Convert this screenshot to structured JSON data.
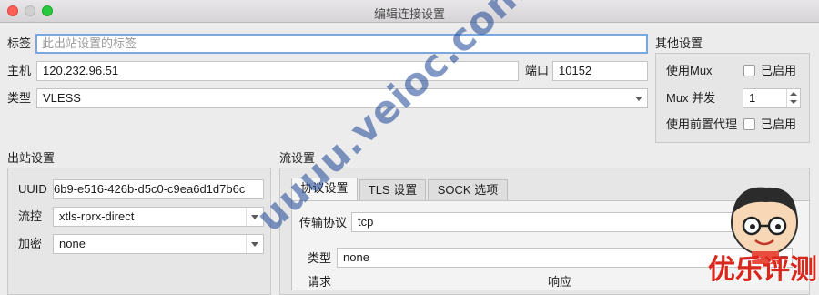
{
  "window": {
    "title": "编辑连接设置"
  },
  "form": {
    "tag_label": "标签",
    "tag_placeholder": "此出站设置的标签",
    "host_label": "主机",
    "host_value": "120.232.96.51",
    "port_label": "端口",
    "port_value": "10152",
    "type_label": "类型",
    "type_value": "VLESS"
  },
  "other_settings": {
    "title": "其他设置",
    "mux_label": "使用Mux",
    "mux_enabled_label": "已启用",
    "mux_enabled": false,
    "mux_concurrency_label": "Mux 并发",
    "mux_concurrency_value": "1",
    "proxy_label": "使用前置代理",
    "proxy_enabled_label": "已启用",
    "proxy_enabled": false
  },
  "outbound": {
    "title": "出站设置",
    "uuid_label": "UUID",
    "uuid_value": "6b9-e516-426b-d5c0-c9ea6d1d7b6c",
    "flow_label": "流控",
    "flow_value": "xtls-rprx-direct",
    "encryption_label": "加密",
    "encryption_value": "none"
  },
  "stream": {
    "title": "流设置",
    "tabs": [
      {
        "label": "协议设置",
        "active": true
      },
      {
        "label": "TLS 设置",
        "active": false
      },
      {
        "label": "SOCK 选项",
        "active": false
      }
    ],
    "transport_label": "传输协议",
    "transport_value": "tcp",
    "header_type_label": "类型",
    "header_type_value": "none",
    "request_label": "请求",
    "response_label": "响应"
  },
  "watermark": {
    "text": "uuuu.veioc.com"
  },
  "badge": {
    "text": "优乐评测网"
  },
  "colors": {
    "accent": "#7aa7e0",
    "badge_red": "#d9271c",
    "watermark": "#1e4696"
  }
}
